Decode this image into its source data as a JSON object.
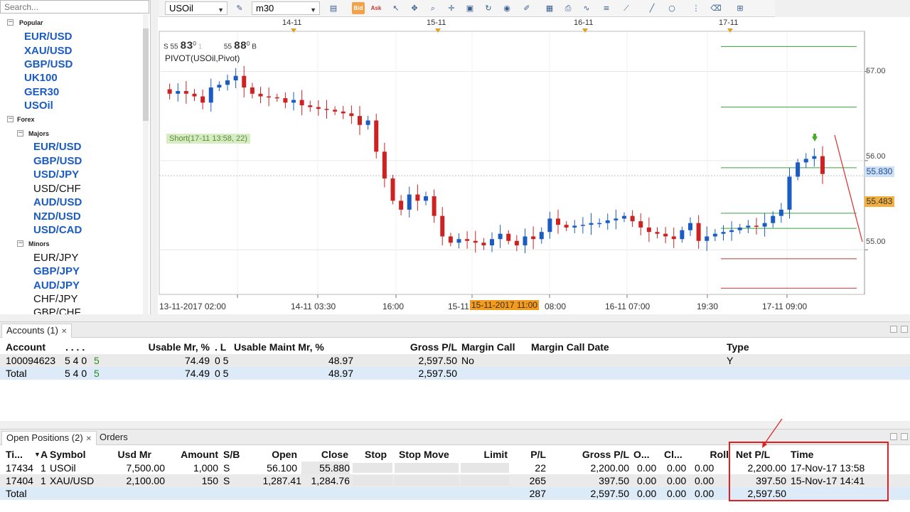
{
  "search": {
    "placeholder": "Search..."
  },
  "tree": {
    "groups": {
      "popular": "Popular",
      "forex": "Forex",
      "majors": "Majors",
      "minors": "Minors"
    },
    "popular": [
      "EUR/USD",
      "XAU/USD",
      "GBP/USD",
      "UK100",
      "GER30",
      "USOil"
    ],
    "majors": [
      {
        "label": "EUR/USD",
        "bold": true
      },
      {
        "label": "GBP/USD",
        "bold": true
      },
      {
        "label": "USD/JPY",
        "bold": true
      },
      {
        "label": "USD/CHF",
        "bold": false
      },
      {
        "label": "AUD/USD",
        "bold": true
      },
      {
        "label": "NZD/USD",
        "bold": true
      },
      {
        "label": "USD/CAD",
        "bold": true
      }
    ],
    "minors": [
      {
        "label": "EUR/JPY",
        "bold": false
      },
      {
        "label": "GBP/JPY",
        "bold": true
      },
      {
        "label": "AUD/JPY",
        "bold": true
      },
      {
        "label": "CHF/JPY",
        "bold": false
      },
      {
        "label": "GBP/CHF",
        "bold": false
      }
    ]
  },
  "toolbar": {
    "instrument": "USOil",
    "timeframe": "m30",
    "bid_label": "Bid",
    "ask_label": "Ask"
  },
  "chart": {
    "ohlc": {
      "s": "S",
      "s_small": "55",
      "s_big": "83",
      "s_sup": "0",
      "s_grey": "1",
      "b_small": "55",
      "b_big": "88",
      "b_sup": "0",
      "b": "B"
    },
    "indicator_label": "PIVOT(USOil,Pivot)",
    "short_label": "Short(17-11 13:58, 22)",
    "price_tags": {
      "bid": "55.830",
      "ask": "55.483"
    },
    "y_ticks": [
      "57.00",
      "56.00",
      "55.00"
    ],
    "x_ticks": [
      "13-11-2017 02:00",
      "14-11 03:30",
      "16:00",
      "15-11",
      "08:00",
      "16-11 07:00",
      "19:30",
      "17-11 09:00"
    ],
    "x_highlight": "15-11-2017 11:00",
    "top_dates": [
      "14-11",
      "15-11",
      "16-11",
      "17-11"
    ],
    "colors": {
      "up": "#1a5bc4",
      "down": "#cc2222",
      "pivot_green": "#3aa03a",
      "pivot_red": "#b03a3a",
      "highlight": "#f59b1c"
    }
  },
  "chart_data": {
    "type": "candlestick",
    "instrument": "USOil",
    "timeframe": "m30",
    "x_ticks": [
      "13-11-2017 02:00",
      "14-11 03:30",
      "16:00",
      "15-11",
      "08:00",
      "16-11 07:00",
      "19:30",
      "17-11 09:00"
    ],
    "y_ticks": [
      57.0,
      56.0,
      55.0
    ],
    "ylim": [
      54.5,
      57.45
    ],
    "pivot_levels": [
      57.28,
      56.6,
      55.92,
      55.41,
      55.24,
      54.9,
      54.57
    ],
    "bid": 55.83,
    "ask": 55.483,
    "close_path": [
      56.8,
      56.75,
      56.78,
      56.75,
      56.72,
      56.65,
      56.82,
      56.85,
      56.9,
      56.95,
      56.82,
      56.75,
      56.72,
      56.71,
      56.7,
      56.65,
      56.68,
      56.62,
      56.6,
      56.58,
      56.57,
      56.55,
      56.53,
      56.5,
      56.4,
      56.45,
      56.1,
      55.8,
      55.55,
      55.45,
      55.62,
      55.55,
      55.6,
      55.38,
      55.15,
      55.08,
      55.12,
      55.1,
      55.08,
      55.05,
      55.12,
      55.18,
      55.1,
      55.05,
      55.15,
      55.12,
      55.2,
      55.35,
      55.28,
      55.25,
      55.27,
      55.28,
      55.3,
      55.3,
      55.33,
      55.35,
      55.38,
      55.32,
      55.25,
      55.2,
      55.18,
      55.15,
      55.12,
      55.22,
      55.3,
      55.1,
      55.15,
      55.18,
      55.2,
      55.22,
      55.25,
      55.27,
      55.26,
      55.3,
      55.38,
      55.45,
      55.82,
      55.98,
      56.02,
      56.05,
      55.85
    ]
  },
  "accounts": {
    "tab": "Accounts (1)",
    "headers": [
      "Account",
      ". . . .",
      "Usable Mr, %",
      ". L",
      "Usable Maint Mr, %",
      "Gross P/L",
      "Margin Call",
      "Margin Call Date",
      "Type"
    ],
    "rows": [
      {
        "account": "100094623",
        "mid": "5 4 0",
        "mid_g": "5",
        "usable_mr": "74.49",
        "l": "0 5",
        "usable_maint": "48.97",
        "gross": "2,597.50",
        "margin_call": "No",
        "margin_call_date": "",
        "type": "Y"
      }
    ],
    "total": {
      "label": "Total",
      "mid": "5 4 0",
      "mid_g": "5",
      "usable_mr": "74.49",
      "l": "0 5",
      "usable_maint": "48.97",
      "gross": "2,597.50"
    }
  },
  "positions": {
    "tab": "Open Positions (2)",
    "orders_tab": "Orders",
    "headers": [
      "Ti...",
      "A",
      "Symbol",
      "Usd Mr",
      "Amount",
      "S/B",
      "Open",
      "Close",
      "Stop",
      "Stop Move",
      "Limit",
      "P/L",
      "Gross P/L",
      "O...",
      "Cl...",
      "Roll",
      "Net P/L",
      "Time"
    ],
    "rows": [
      {
        "ticket": "17434",
        "a": "1",
        "symbol": "USOil",
        "usd_mr": "7,500.00",
        "amount": "1,000",
        "sb": "S",
        "open": "56.100",
        "close": "55.880",
        "pl": "22",
        "gross": "2,200.00",
        "o": "0.00",
        "cl": "0.00",
        "roll": "0.00",
        "net": "2,200.00",
        "time": "17-Nov-17 13:58"
      },
      {
        "ticket": "17404",
        "a": "1",
        "symbol": "XAU/USD",
        "usd_mr": "2,100.00",
        "amount": "150",
        "sb": "S",
        "open": "1,287.41",
        "close": "1,284.76",
        "pl": "265",
        "gross": "397.50",
        "o": "0.00",
        "cl": "0.00",
        "roll": "0.00",
        "net": "397.50",
        "time": "15-Nov-17 14:41"
      }
    ],
    "total": {
      "label": "Total",
      "pl": "287",
      "gross": "2,597.50",
      "o": "0.00",
      "cl": "0.00",
      "roll": "0.00",
      "net": "2,597.50"
    }
  }
}
